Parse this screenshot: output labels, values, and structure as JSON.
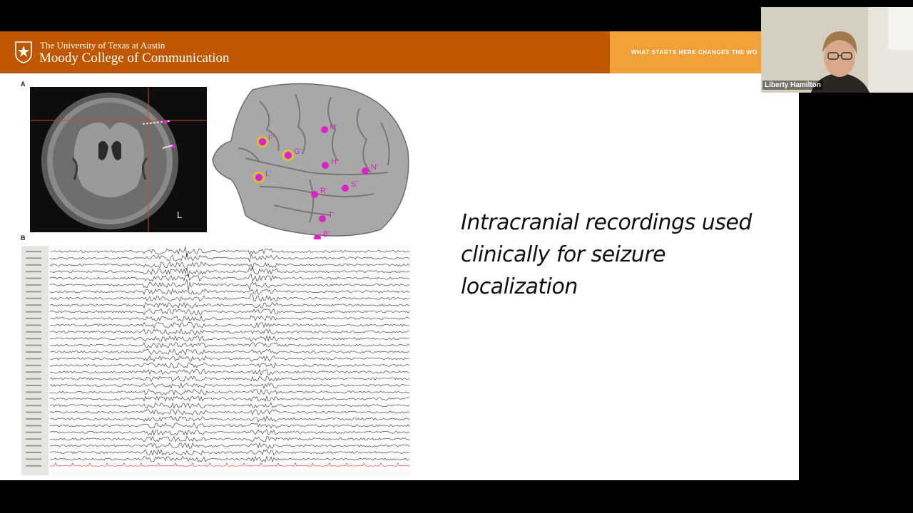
{
  "banner": {
    "university": "The University of Texas at Austin",
    "college": "Moody College of Communication",
    "tagline": "WHAT STARTS HERE CHANGES THE WO",
    "colors": {
      "burnt_orange": "#bf5700",
      "accent_orange": "#f0a13a"
    }
  },
  "figure": {
    "panel_a_label": "A",
    "panel_b_label": "B",
    "mri_side_label": "L",
    "electrodes": [
      "F'",
      "G'",
      "L'",
      "M'",
      "H'",
      "N'",
      "S'",
      "R'",
      "T'",
      "B'",
      "I'"
    ]
  },
  "slide": {
    "caption": "Intracranial recordings used clinically for seizure localization"
  },
  "webcam": {
    "participant_name": "Liberty Hamilton"
  }
}
